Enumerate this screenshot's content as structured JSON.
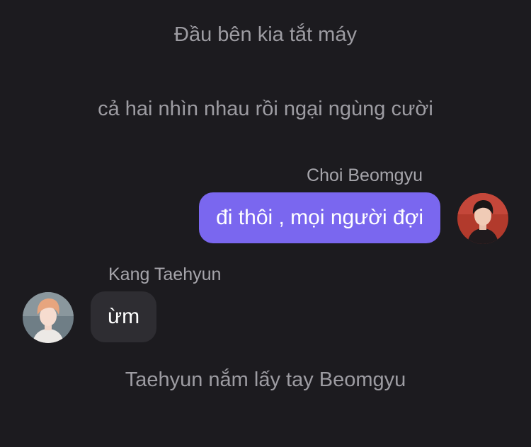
{
  "conversation": {
    "narration_1": "Đầu bên kia tắt máy",
    "narration_2": "cả hai nhìn nhau rồi ngại ngùng cười",
    "message_1": {
      "sender": "Choi Beomgyu",
      "text": "đi thôi , mọi người đợi",
      "avatar": "avatar-choi-beomgyu"
    },
    "message_2": {
      "sender": "Kang Taehyun",
      "text": "ừm",
      "avatar": "avatar-kang-taehyun"
    },
    "narration_3": "Taehyun nắm lấy tay Beomgyu"
  },
  "colors": {
    "background": "#1c1b1f",
    "outgoing_bubble": "#7a67ef",
    "incoming_bubble": "#2e2d32",
    "narration_text": "#9d9ca2"
  }
}
